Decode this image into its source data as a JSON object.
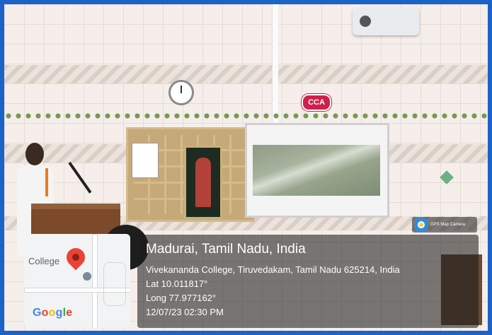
{
  "photo": {
    "wall_sign": "CCA"
  },
  "geotag": {
    "app_badge": "GPS Map Camera",
    "app_icon": "gps-map-camera-icon",
    "location_title": "Madurai, Tamil Nadu, India",
    "address": "Vivekananda College, Tiruvedakam, Tamil Nadu 625214, India",
    "latitude": "Lat 10.011817°",
    "longitude": "Long 77.977162°",
    "datetime": "12/07/23 02:30 PM"
  },
  "map": {
    "place_label": "College",
    "provider": "Google",
    "pin_icon": "location-pin-icon",
    "pin_color": "#ea4335"
  },
  "colors": {
    "frame_border": "#1b63c6",
    "overlay_bg": "rgba(28,28,28,.58)",
    "cca_badge": "#d01f4b"
  }
}
